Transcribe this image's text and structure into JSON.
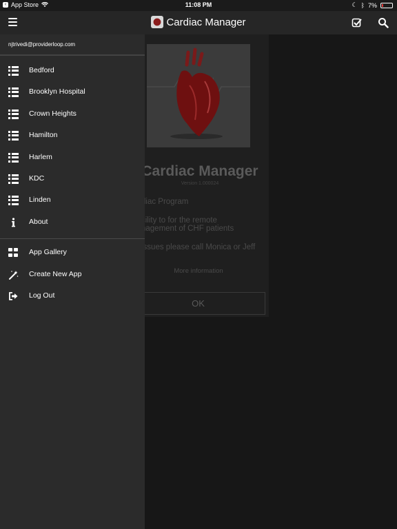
{
  "status_bar": {
    "back_label": "App Store",
    "time": "11:08 PM",
    "battery": "7%"
  },
  "header": {
    "title": "Cardiac Manager"
  },
  "drawer": {
    "email": "njtrivedi@providerloop.com",
    "locations": [
      {
        "label": "Bedford",
        "icon": "list-icon"
      },
      {
        "label": "Brooklyn Hospital",
        "icon": "list-icon"
      },
      {
        "label": "Crown Heights",
        "icon": "list-icon"
      },
      {
        "label": "Hamilton",
        "icon": "list-icon"
      },
      {
        "label": "Harlem",
        "icon": "list-icon"
      },
      {
        "label": "KDC",
        "icon": "list-icon"
      },
      {
        "label": "Linden",
        "icon": "list-icon"
      }
    ],
    "about_label": "About",
    "actions": [
      {
        "label": "App Gallery",
        "icon": "grid-icon"
      },
      {
        "label": "Create New App",
        "icon": "magic-wand-icon"
      },
      {
        "label": "Log Out",
        "icon": "logout-icon"
      }
    ]
  },
  "about": {
    "title": "Cardiac Manager",
    "version": "Version 1.000024",
    "line1": "diac Program",
    "line2": "cility to for the remote",
    "line3": "nagement of CHF patients",
    "line4": "issues please call Monica or Jeff",
    "more_info": "More information",
    "ok_label": "OK"
  },
  "colors": {
    "drawer_bg": "#2b2b2b",
    "header_bg": "#262626",
    "page_bg": "#131313"
  }
}
